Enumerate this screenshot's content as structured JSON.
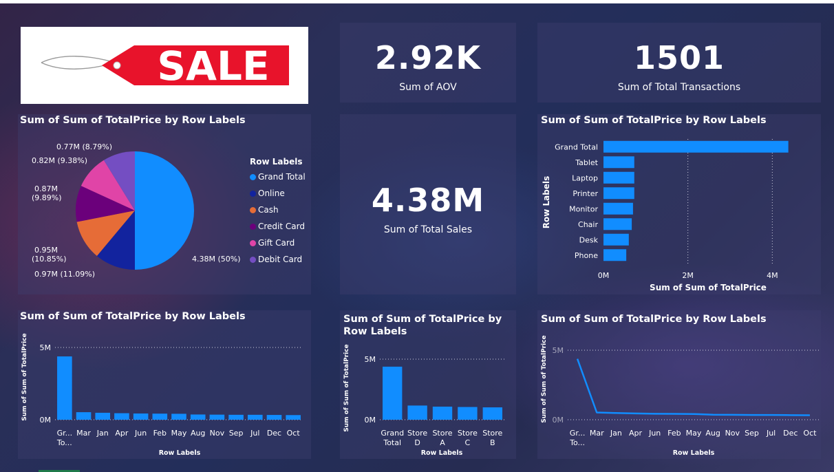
{
  "logo": {
    "text": "SALE",
    "colors": {
      "tag": "#e8132b",
      "text": "#ffffff"
    }
  },
  "kpis": {
    "aov": {
      "value": "2.92K",
      "label": "Sum of AOV"
    },
    "transactions": {
      "value": "1501",
      "label": "Sum of Total Transactions"
    },
    "sales": {
      "value": "4.38M",
      "label": "Sum of Total Sales"
    }
  },
  "colors": {
    "bar": "#118dff",
    "text": "#ffffff",
    "grid": "#d0d0e0"
  },
  "chart_data": [
    {
      "id": "pie",
      "type": "pie",
      "title": "Sum of Sum of TotalPrice by Row Labels",
      "legend_title": "Row Labels",
      "legend_position": "right",
      "slices": [
        {
          "label": "Grand Total",
          "value": 4.38,
          "data_label": "4.38M (50%)",
          "color": "#118dff"
        },
        {
          "label": "Online",
          "value": 0.97,
          "data_label": "0.97M (11.09%)",
          "color": "#12239e"
        },
        {
          "label": "Cash",
          "value": 0.95,
          "data_label": "0.95M (10.85%)",
          "color": "#e66c37"
        },
        {
          "label": "Credit Card",
          "value": 0.87,
          "data_label": "0.87M (9.89%)",
          "color": "#6b007b"
        },
        {
          "label": "Gift Card",
          "value": 0.82,
          "data_label": "0.82M (9.38%)",
          "color": "#e044a7"
        },
        {
          "label": "Debit Card",
          "value": 0.77,
          "data_label": "0.77M (8.79%)",
          "color": "#744ec2"
        }
      ]
    },
    {
      "id": "hbar",
      "type": "bar",
      "orientation": "horizontal",
      "title": "Sum of Sum of TotalPrice by Row Labels",
      "xlabel": "Sum of Sum of TotalPrice",
      "ylabel": "Row Labels",
      "xlim": [
        0,
        4.5
      ],
      "xticks": [
        0,
        2,
        4
      ],
      "xtick_labels": [
        "0M",
        "2M",
        "4M"
      ],
      "grid": true,
      "categories": [
        "Grand Total",
        "Tablet",
        "Laptop",
        "Printer",
        "Monitor",
        "Chair",
        "Desk",
        "Phone"
      ],
      "values": [
        4.38,
        0.73,
        0.73,
        0.73,
        0.7,
        0.67,
        0.6,
        0.54
      ]
    },
    {
      "id": "months_bar",
      "type": "bar",
      "title": "Sum of Sum of TotalPrice by Row Labels",
      "xlabel": "Row Labels",
      "ylabel": "Sum of Sum of TotalPrice",
      "ylim": [
        0,
        5
      ],
      "yticks": [
        0,
        5
      ],
      "ytick_labels": [
        "0M",
        "5M"
      ],
      "grid": true,
      "categories": [
        "Gr... To...",
        "Mar",
        "Jan",
        "Apr",
        "Jun",
        "Feb",
        "May",
        "Aug",
        "Nov",
        "Sep",
        "Jul",
        "Dec",
        "Oct"
      ],
      "values": [
        4.38,
        0.52,
        0.48,
        0.45,
        0.43,
        0.42,
        0.41,
        0.36,
        0.35,
        0.34,
        0.34,
        0.33,
        0.32
      ]
    },
    {
      "id": "stores_bar",
      "type": "bar",
      "title": "Sum of Sum of TotalPrice by Row Labels",
      "xlabel": "Row Labels",
      "ylabel": "Sum of Sum of TotalPrice",
      "ylim": [
        0,
        5
      ],
      "yticks": [
        0,
        5
      ],
      "ytick_labels": [
        "0M",
        "5M"
      ],
      "grid": true,
      "categories": [
        "Grand Total",
        "Store D",
        "Store A",
        "Store C",
        "Store B"
      ],
      "values": [
        4.38,
        1.17,
        1.08,
        1.05,
        1.02
      ]
    },
    {
      "id": "months_line",
      "type": "line",
      "title": "Sum of Sum of TotalPrice by Row Labels",
      "xlabel": "Row Labels",
      "ylabel": "Sum of Sum of TotalPrice",
      "ylim": [
        0,
        5
      ],
      "yticks": [
        0,
        5
      ],
      "ytick_labels": [
        "0M",
        "5M"
      ],
      "grid": true,
      "categories": [
        "Gr... To...",
        "Mar",
        "Jan",
        "Apr",
        "Jun",
        "Feb",
        "May",
        "Aug",
        "Nov",
        "Sep",
        "Jul",
        "Dec",
        "Oct"
      ],
      "values": [
        4.38,
        0.52,
        0.48,
        0.45,
        0.43,
        0.42,
        0.41,
        0.36,
        0.35,
        0.34,
        0.34,
        0.33,
        0.32
      ]
    }
  ]
}
